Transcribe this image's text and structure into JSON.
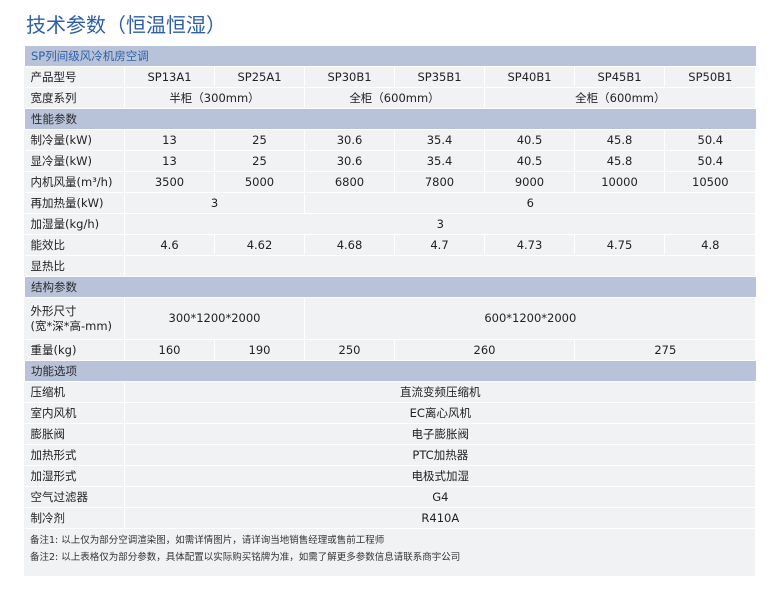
{
  "title": "技术参数（恒温恒湿）",
  "series_header": "SP列间级风冷机房空调",
  "labels": {
    "model": "产品型号",
    "width_series": "宽度系列",
    "performance": "性能参数",
    "cooling": "制冷量(kW)",
    "sensible": "显冷量(kW)",
    "airflow": "内机风量(m³/h)",
    "reheat": "再加热量(kW)",
    "humidify": "加湿量(kg/h)",
    "eer": "能效比",
    "shr": "显热比",
    "structure": "结构参数",
    "dims_line1": "外形尺寸",
    "dims_line2": "(宽*深*高-mm)",
    "weight": "重量(kg)",
    "options": "功能选项",
    "compressor": "压缩机",
    "indoor_fan": "室内风机",
    "valve": "膨胀阀",
    "heating_type": "加热形式",
    "humidify_type": "加湿形式",
    "filter": "空气过滤器",
    "refrigerant": "制冷剂"
  },
  "models": [
    "SP13A1",
    "SP25A1",
    "SP30B1",
    "SP35B1",
    "SP40B1",
    "SP45B1",
    "SP50B1"
  ],
  "width_series": [
    "半柜（300mm）",
    "全柜（600mm）",
    "全柜（600mm）"
  ],
  "cooling": [
    "13",
    "25",
    "30.6",
    "35.4",
    "40.5",
    "45.8",
    "50.4"
  ],
  "sensible": [
    "13",
    "25",
    "30.6",
    "35.4",
    "40.5",
    "45.8",
    "50.4"
  ],
  "airflow": [
    "3500",
    "5000",
    "6800",
    "7800",
    "9000",
    "10000",
    "10500"
  ],
  "reheat": [
    "3",
    "6"
  ],
  "humidify": "3",
  "eer": [
    "4.6",
    "4.62",
    "4.68",
    "4.7",
    "4.73",
    "4.75",
    "4.8"
  ],
  "dims": [
    "300*1200*2000",
    "600*1200*2000"
  ],
  "weight": [
    "160",
    "190",
    "250",
    "260",
    "275"
  ],
  "options": {
    "compressor": "直流变频压缩机",
    "indoor_fan": "EC离心风机",
    "valve": "电子膨胀阀",
    "heating_type": "PTC加热器",
    "humidify_type": "电极式加湿",
    "filter": "G4",
    "refrigerant": "R410A"
  },
  "notes": [
    "备注1: 以上仅为部分空调渲染图，如需详情图片，请详询当地销售经理或售前工程师",
    "备注2: 以上表格仅为部分参数，具体配置以实际购买铭牌为准，如需了解更多参数信息请联系商宇公司"
  ]
}
